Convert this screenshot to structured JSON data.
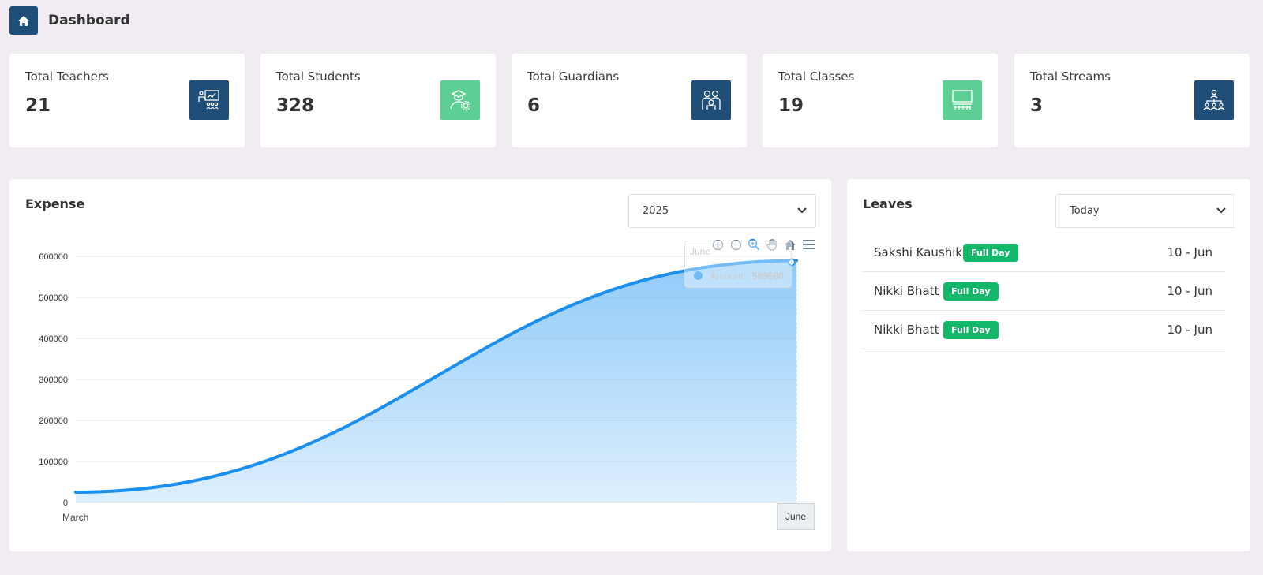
{
  "header": {
    "title": "Dashboard",
    "home_icon": "home-icon"
  },
  "stats": [
    {
      "label": "Total Teachers",
      "value": "21",
      "icon": "teacher-board-icon",
      "color": "#1f4e79"
    },
    {
      "label": "Total Students",
      "value": "328",
      "icon": "student-graduate-icon",
      "color": "#5dcf95"
    },
    {
      "label": "Total Guardians",
      "value": "6",
      "icon": "guardians-icon",
      "color": "#1f4e79"
    },
    {
      "label": "Total Classes",
      "value": "19",
      "icon": "classroom-icon",
      "color": "#5dcf95"
    },
    {
      "label": "Total Streams",
      "value": "3",
      "icon": "hierarchy-icon",
      "color": "#1f4e79"
    }
  ],
  "expense": {
    "title": "Expense",
    "year_select": "2025",
    "tooltip": {
      "title": "June",
      "series": "Amount:",
      "value": "589500"
    },
    "crosshair_label": "June"
  },
  "chart_data": {
    "type": "area",
    "title": "Expense",
    "x": [
      "March",
      "June"
    ],
    "series": [
      {
        "name": "Amount",
        "values": [
          25000,
          589500
        ],
        "color": "#2196f3"
      }
    ],
    "ylim": [
      0,
      600000
    ],
    "yticks": [
      "0",
      "100000",
      "200000",
      "300000",
      "400000",
      "500000",
      "600000"
    ],
    "xticks": [
      "March"
    ],
    "grid": true,
    "toolbar": [
      "zoom-in-icon",
      "zoom-out-icon",
      "selection-zoom-icon",
      "pan-hand-icon",
      "reset-home-icon",
      "menu-icon"
    ]
  },
  "leaves": {
    "title": "Leaves",
    "filter_select": "Today",
    "rows": [
      {
        "name": "Sakshi Kaushik",
        "type": "Full Day",
        "date": "10 - Jun"
      },
      {
        "name": "Nikki Bhatt",
        "type": "Full Day",
        "date": "10 - Jun"
      },
      {
        "name": "Nikki Bhatt",
        "type": "Full Day",
        "date": "10 - Jun"
      }
    ]
  }
}
